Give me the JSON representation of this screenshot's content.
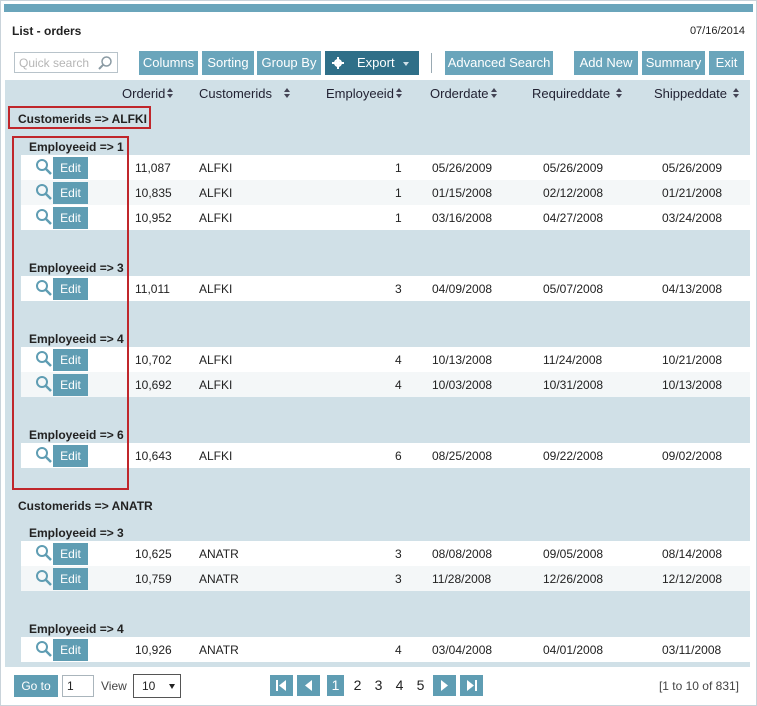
{
  "header": {
    "title": "List - orders",
    "date": "07/16/2014"
  },
  "toolbar": {
    "search_placeholder": "Quick search",
    "columns": "Columns",
    "sorting": "Sorting",
    "group_by": "Group By",
    "export": "Export",
    "advanced_search": "Advanced Search",
    "add_new": "Add New",
    "summary": "Summary",
    "exit": "Exit"
  },
  "columns": [
    "Orderid",
    "Customerids",
    "Employeeid",
    "Orderdate",
    "Requireddate",
    "Shippeddate"
  ],
  "edit_label": "Edit",
  "groups": {
    "alfki": {
      "label": "Customerids => ALFKI",
      "e1": {
        "label": "Employeeid => 1",
        "rows": [
          [
            "11,087",
            "ALFKI",
            "1",
            "05/26/2009",
            "05/26/2009",
            "05/26/2009"
          ],
          [
            "10,835",
            "ALFKI",
            "1",
            "01/15/2008",
            "02/12/2008",
            "01/21/2008"
          ],
          [
            "10,952",
            "ALFKI",
            "1",
            "03/16/2008",
            "04/27/2008",
            "03/24/2008"
          ]
        ]
      },
      "e3": {
        "label": "Employeeid => 3",
        "rows": [
          [
            "11,011",
            "ALFKI",
            "3",
            "04/09/2008",
            "05/07/2008",
            "04/13/2008"
          ]
        ]
      },
      "e4": {
        "label": "Employeeid => 4",
        "rows": [
          [
            "10,702",
            "ALFKI",
            "4",
            "10/13/2008",
            "11/24/2008",
            "10/21/2008"
          ],
          [
            "10,692",
            "ALFKI",
            "4",
            "10/03/2008",
            "10/31/2008",
            "10/13/2008"
          ]
        ]
      },
      "e6": {
        "label": "Employeeid => 6",
        "rows": [
          [
            "10,643",
            "ALFKI",
            "6",
            "08/25/2008",
            "09/22/2008",
            "09/02/2008"
          ]
        ]
      }
    },
    "anatr": {
      "label": "Customerids => ANATR",
      "e3": {
        "label": "Employeeid => 3",
        "rows": [
          [
            "10,625",
            "ANATR",
            "3",
            "08/08/2008",
            "09/05/2008",
            "08/14/2008"
          ],
          [
            "10,759",
            "ANATR",
            "3",
            "11/28/2008",
            "12/26/2008",
            "12/12/2008"
          ]
        ]
      },
      "e4": {
        "label": "Employeeid => 4",
        "rows": [
          [
            "10,926",
            "ANATR",
            "4",
            "03/04/2008",
            "04/01/2008",
            "03/11/2008"
          ]
        ]
      }
    }
  },
  "footer": {
    "go_to": "Go to",
    "page_value": "1",
    "view_label": "View",
    "view_value": "10",
    "pages": [
      "1",
      "2",
      "3",
      "4",
      "5"
    ],
    "range": "[1 to 10 of 831]"
  },
  "colors": {
    "accent": "#6aa5bb",
    "accent_dark": "#2f6f88",
    "grid_bg": "#d0e0e7",
    "highlight": "#c0262b"
  }
}
